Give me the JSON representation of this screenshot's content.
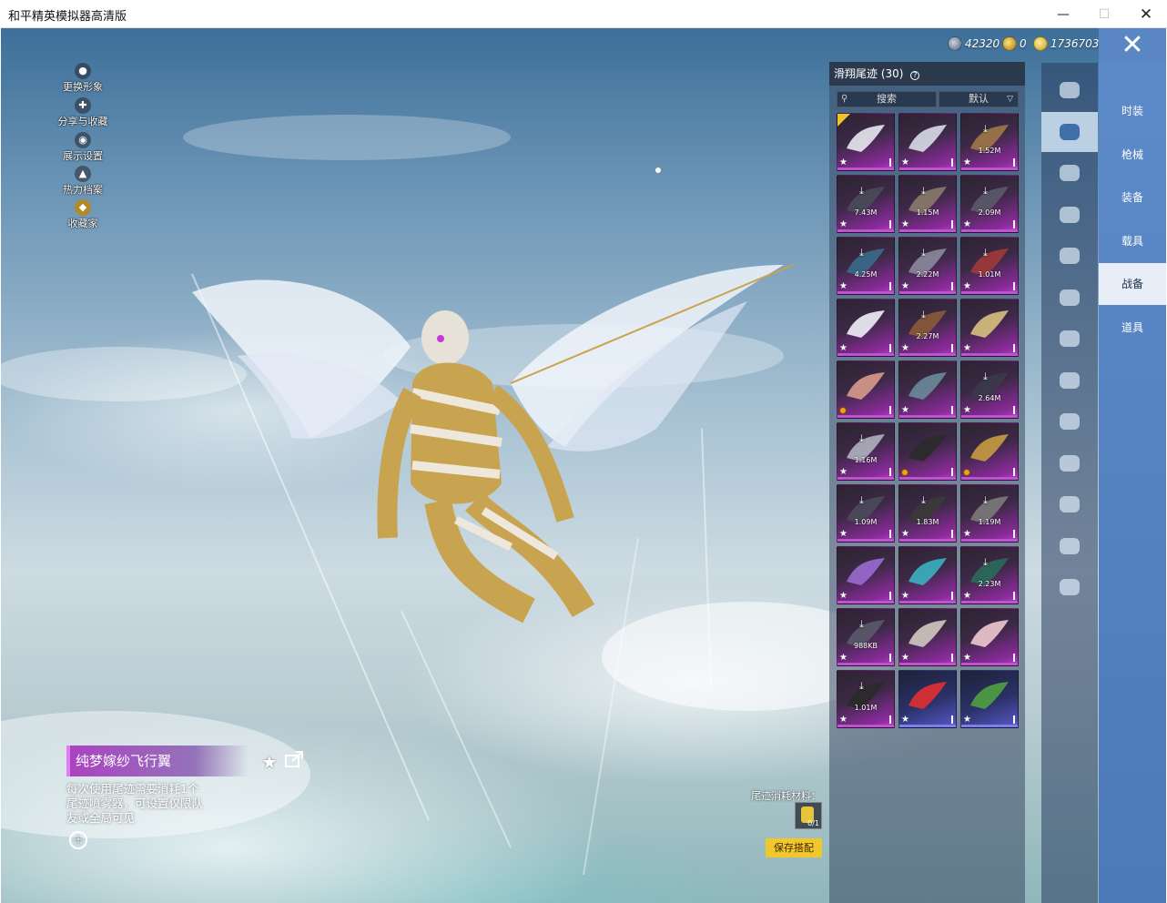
{
  "window": {
    "title": "和平精英模拟器高清版",
    "min_glyph": "—",
    "max_glyph": "☐",
    "close_glyph": "✕"
  },
  "currency": [
    {
      "icon": "silver-coin-icon",
      "value": "42320"
    },
    {
      "icon": "gold-coin-icon",
      "value": "0"
    },
    {
      "icon": "coupon-coin-icon",
      "value": "1736703"
    }
  ],
  "close_button_glyph": "✕",
  "left_menu": [
    {
      "icon": "avatar-icon",
      "glyph": "●",
      "label": "更换形象"
    },
    {
      "icon": "share-icon",
      "glyph": "✚",
      "label": "分享与收藏"
    },
    {
      "icon": "eye-icon",
      "glyph": "◉",
      "label": "展示设置"
    },
    {
      "icon": "fire-icon",
      "glyph": "▲",
      "label": "热力档案"
    },
    {
      "icon": "badge-icon",
      "glyph": "◆",
      "label": "收藏家"
    }
  ],
  "item": {
    "name": "纯梦嫁纱飞行翼",
    "description": "每次使用尾迹需要消耗1个尾迹喷雾器，可设置仅限队友或全局可见",
    "zoom_glyph": "+",
    "favorite_glyph": "★"
  },
  "material": {
    "label": "尾迹消耗材料：",
    "count": "0/1"
  },
  "save_button": "保存搭配",
  "inventory": {
    "title": "滑翔尾迹 (30)",
    "help_glyph": "?",
    "search_placeholder": "搜索",
    "sort_value": "默认",
    "items": [
      {
        "size": "",
        "downloadable": false,
        "badge": "star",
        "selected": true,
        "color": "purple"
      },
      {
        "size": "",
        "downloadable": false,
        "badge": "star",
        "selected": false,
        "color": "purple"
      },
      {
        "size": "1.52M",
        "downloadable": true,
        "badge": "star",
        "selected": false,
        "color": "purple"
      },
      {
        "size": "7.43M",
        "downloadable": true,
        "badge": "star",
        "selected": false,
        "color": "purple"
      },
      {
        "size": "1.15M",
        "downloadable": true,
        "badge": "star",
        "selected": false,
        "color": "purple"
      },
      {
        "size": "2.09M",
        "downloadable": true,
        "badge": "star",
        "selected": false,
        "color": "purple"
      },
      {
        "size": "4.25M",
        "downloadable": true,
        "badge": "star",
        "selected": false,
        "color": "purple"
      },
      {
        "size": "2.22M",
        "downloadable": true,
        "badge": "star",
        "selected": false,
        "color": "purple"
      },
      {
        "size": "1.01M",
        "downloadable": true,
        "badge": "star",
        "selected": false,
        "color": "purple"
      },
      {
        "size": "",
        "downloadable": false,
        "badge": "star",
        "selected": false,
        "color": "purple"
      },
      {
        "size": "2.27M",
        "downloadable": true,
        "badge": "star",
        "selected": false,
        "color": "purple"
      },
      {
        "size": "",
        "downloadable": false,
        "badge": "star",
        "selected": false,
        "color": "purple"
      },
      {
        "size": "",
        "downloadable": false,
        "badge": "coin",
        "selected": false,
        "color": "purple"
      },
      {
        "size": "",
        "downloadable": false,
        "badge": "star",
        "selected": false,
        "color": "purple"
      },
      {
        "size": "2.64M",
        "downloadable": true,
        "badge": "star",
        "selected": false,
        "color": "purple"
      },
      {
        "size": "1.16M",
        "downloadable": true,
        "badge": "star",
        "selected": false,
        "color": "purple"
      },
      {
        "size": "",
        "downloadable": false,
        "badge": "coin",
        "selected": false,
        "color": "purple"
      },
      {
        "size": "",
        "downloadable": false,
        "badge": "coin",
        "selected": false,
        "color": "purple"
      },
      {
        "size": "1.09M",
        "downloadable": true,
        "badge": "star",
        "selected": false,
        "color": "purple"
      },
      {
        "size": "1.83M",
        "downloadable": true,
        "badge": "star",
        "selected": false,
        "color": "purple"
      },
      {
        "size": "1.19M",
        "downloadable": true,
        "badge": "star",
        "selected": false,
        "color": "purple"
      },
      {
        "size": "",
        "downloadable": false,
        "badge": "star",
        "selected": false,
        "color": "purple"
      },
      {
        "size": "",
        "downloadable": false,
        "badge": "star",
        "selected": false,
        "color": "purple"
      },
      {
        "size": "2.23M",
        "downloadable": true,
        "badge": "star",
        "selected": false,
        "color": "purple"
      },
      {
        "size": "988KB",
        "downloadable": true,
        "badge": "star",
        "selected": false,
        "color": "purple"
      },
      {
        "size": "",
        "downloadable": false,
        "badge": "star",
        "selected": false,
        "color": "purple"
      },
      {
        "size": "",
        "downloadable": false,
        "badge": "star",
        "selected": false,
        "color": "purple"
      },
      {
        "size": "1.01M",
        "downloadable": true,
        "badge": "star",
        "selected": false,
        "color": "purple"
      },
      {
        "size": "",
        "downloadable": false,
        "badge": "star",
        "selected": false,
        "color": "blue"
      },
      {
        "size": "",
        "downloadable": false,
        "badge": "star",
        "selected": false,
        "color": "blue"
      }
    ]
  },
  "categories": [
    {
      "name": "parachute-icon",
      "active": false
    },
    {
      "name": "glider-icon",
      "active": true
    },
    {
      "name": "plane-icon",
      "active": false
    },
    {
      "name": "jet-icon",
      "active": false
    },
    {
      "name": "emote-icon",
      "active": false
    },
    {
      "name": "pet-icon",
      "active": false
    },
    {
      "name": "sound-icon",
      "active": false
    },
    {
      "name": "chat-icon",
      "active": false
    },
    {
      "name": "photo-icon",
      "active": false
    },
    {
      "name": "spray-icon",
      "active": false
    },
    {
      "name": "gesture-icon",
      "active": false
    },
    {
      "name": "magic-icon",
      "active": false
    },
    {
      "name": "ufo-icon",
      "active": false
    }
  ],
  "tabs": [
    {
      "label": "时装",
      "active": false
    },
    {
      "label": "枪械",
      "active": false
    },
    {
      "label": "装备",
      "active": false
    },
    {
      "label": "载具",
      "active": false
    },
    {
      "label": "战备",
      "active": true
    },
    {
      "label": "道具",
      "active": false
    }
  ]
}
